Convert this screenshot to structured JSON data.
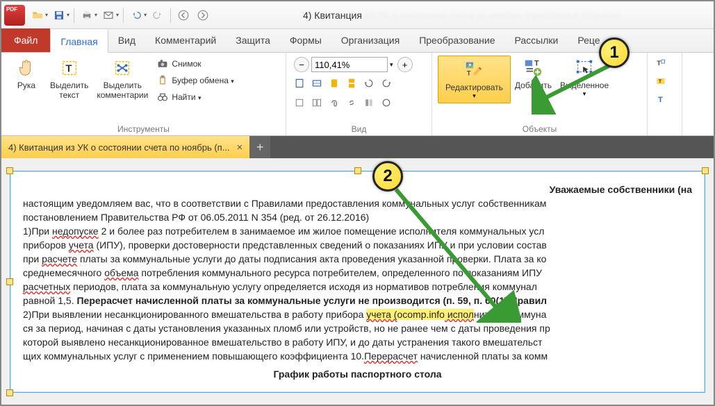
{
  "app": {
    "title_main": "4) Квитанция",
    "title_rest": "из УК о состоянии счета по ноябрь (прислала в соцсети)"
  },
  "tabs": {
    "file": "Файл",
    "items": [
      "Главная",
      "Вид",
      "Комментарий",
      "Защита",
      "Формы",
      "Организация",
      "Преобразование",
      "Рассылки",
      "Реце"
    ],
    "active": 0
  },
  "ribbon": {
    "group_tools": {
      "label": "Инструменты",
      "hand": "Рука",
      "select_text": "Выделить\nтекст",
      "select_comments": "Выделить\nкомментарии",
      "snapshot": "Снимок",
      "clipboard": "Буфер обмена",
      "find": "Найти"
    },
    "group_view": {
      "label": "Вид",
      "zoom_value": "110,41%"
    },
    "group_objects": {
      "label": "Объекты",
      "edit": "Редактировать",
      "add": "Добавить",
      "selected": "Выделенное"
    }
  },
  "doctab": {
    "title": "4) Квитанция из УК о состоянии счета по ноябрь (п..."
  },
  "callouts": {
    "one": "1",
    "two": "2"
  },
  "doc": {
    "hdr1": "Уважаемые собственники (на",
    "p1a": "настоящим уведомляем вас, что в соответствии с Правилами предоставления коммунальных услуг собственникам",
    "p1b": "постановлением Правительства РФ от 06.05.2011 N 354 (ред. от 26.12.2016)",
    "p2": "1)При ",
    "p2u": "недопуске",
    "p2c": " 2 и более раз потребителем в занимаемое им жилое помещение исполнителя коммунальных усл",
    "p3a": "приборов ",
    "p3u": "учета",
    "p3b": " (ИПУ), проверки достоверности представленных сведений о показаниях ИПУ и при условии состав",
    "p4a": "при ",
    "p4u": "расчете",
    "p4b": " платы за коммунальные услуги до даты подписания акта проведения указанной проверки. Плата за ко",
    "p5a": "среднемесячного ",
    "p5u": "объема",
    "p5b": " потребления коммунального ресурса потребителем, определенного по показаниям ИПУ ",
    "p6a": "расчетных",
    "p6b": " периодов, плата за коммунальную услугу определяется исходя из нормативов потребления коммунал",
    "p7a": "равной 1,5. ",
    "p7b": "Перерасчет начисленной платы за коммунальные услуги не производится (п. 59, п. 60(1) Правил",
    "p8a": "2)При выявлении несанкционированного вмешательства в работу прибора ",
    "p8h1": "учета (",
    "p8h2": "ocomp.info",
    "p8h3": " испол",
    "p8b": "нитель коммуна",
    "p9": "ся за период, начиная с даты установления указанных пломб или устройств, но не ранее чем с даты проведения пр",
    "p10": "которой выявлено несанкционированное вмешательство в работу ИПУ, и до даты устранения такого вмешательст",
    "p11a": "щих коммунальных услуг с применением повышающего коэффициента 10.",
    "p11u": "Перерасчет",
    "p11b": " начисленной платы за комм",
    "hdr2": "График работы паспортного стола"
  }
}
